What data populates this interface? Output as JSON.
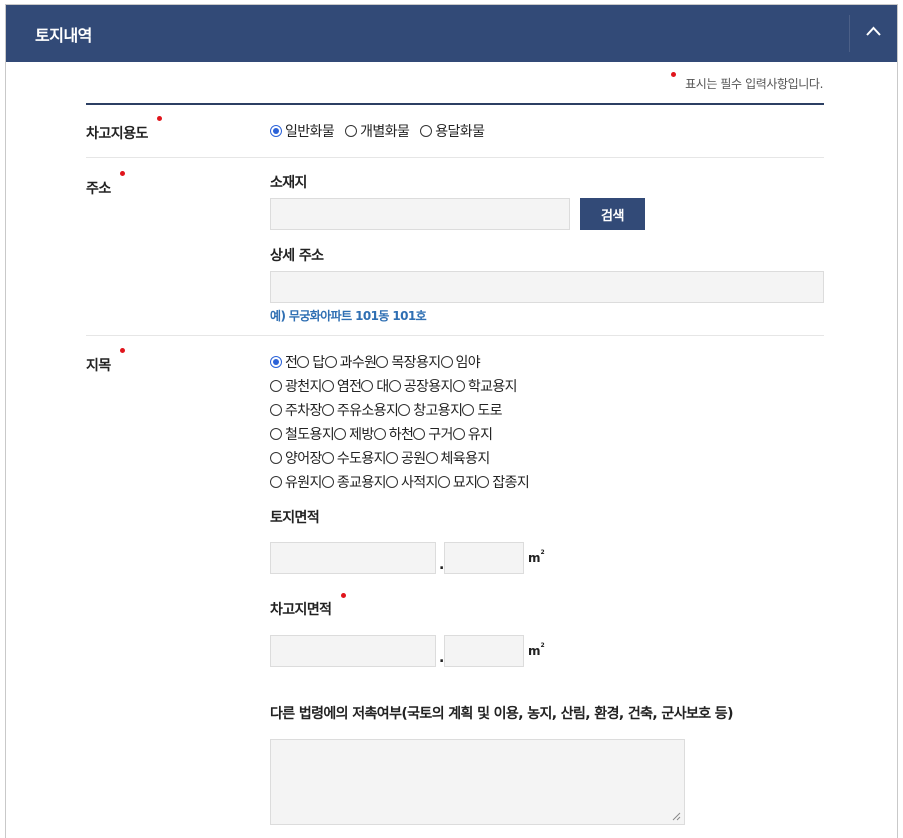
{
  "panel": {
    "title": "토지내역",
    "collapse_icon": "chevron-up-icon"
  },
  "legend": {
    "text": "표시는 필수 입력사항입니다."
  },
  "colors": {
    "header_bg": "#324a77",
    "required": "#e0151c",
    "radio_checked": "#2b62d8",
    "example_text": "#2f6fb3"
  },
  "usage": {
    "label": "차고지용도",
    "options": [
      {
        "label": "일반화물",
        "checked": true
      },
      {
        "label": "개별화물",
        "checked": false
      },
      {
        "label": "용달화물",
        "checked": false
      }
    ]
  },
  "address": {
    "label": "주소",
    "location_label": "소재지",
    "location_value": "",
    "search_button": "검색",
    "detail_label": "상세 주소",
    "detail_value": "",
    "example": "예) 무궁화아파트 101동 101호"
  },
  "jimok": {
    "label": "지목",
    "rows": [
      [
        {
          "label": "전",
          "checked": true
        },
        {
          "label": "답",
          "checked": false
        },
        {
          "label": "과수원",
          "checked": false
        },
        {
          "label": "목장용지",
          "checked": false
        },
        {
          "label": "임야",
          "checked": false
        }
      ],
      [
        {
          "label": "광천지",
          "checked": false
        },
        {
          "label": "염전",
          "checked": false
        },
        {
          "label": "대",
          "checked": false
        },
        {
          "label": "공장용지",
          "checked": false
        },
        {
          "label": "학교용지",
          "checked": false
        }
      ],
      [
        {
          "label": "주차장",
          "checked": false
        },
        {
          "label": "주유소용지",
          "checked": false
        },
        {
          "label": "창고용지",
          "checked": false
        },
        {
          "label": "도로",
          "checked": false
        }
      ],
      [
        {
          "label": "철도용지",
          "checked": false
        },
        {
          "label": "제방",
          "checked": false
        },
        {
          "label": "하천",
          "checked": false
        },
        {
          "label": "구거",
          "checked": false
        },
        {
          "label": "유지",
          "checked": false
        }
      ],
      [
        {
          "label": "양어장",
          "checked": false
        },
        {
          "label": "수도용지",
          "checked": false
        },
        {
          "label": "공원",
          "checked": false
        },
        {
          "label": "체육용지",
          "checked": false
        }
      ],
      [
        {
          "label": "유원지",
          "checked": false
        },
        {
          "label": "종교용지",
          "checked": false
        },
        {
          "label": "사적지",
          "checked": false
        },
        {
          "label": "묘지",
          "checked": false
        },
        {
          "label": "잡종지",
          "checked": false
        }
      ]
    ],
    "land_area_label": "토지면적",
    "land_area_int": "",
    "land_area_dec": "",
    "garage_area_label": "차고지면적",
    "garage_area_int": "",
    "garage_area_dec": "",
    "dot": ".",
    "unit": "m",
    "unit_sup": "2",
    "law_label": "다른 법령에의 저촉여부(국토의 계획 및 이용, 농지, 산림, 환경, 건축, 군사보호 등)",
    "law_value": ""
  }
}
